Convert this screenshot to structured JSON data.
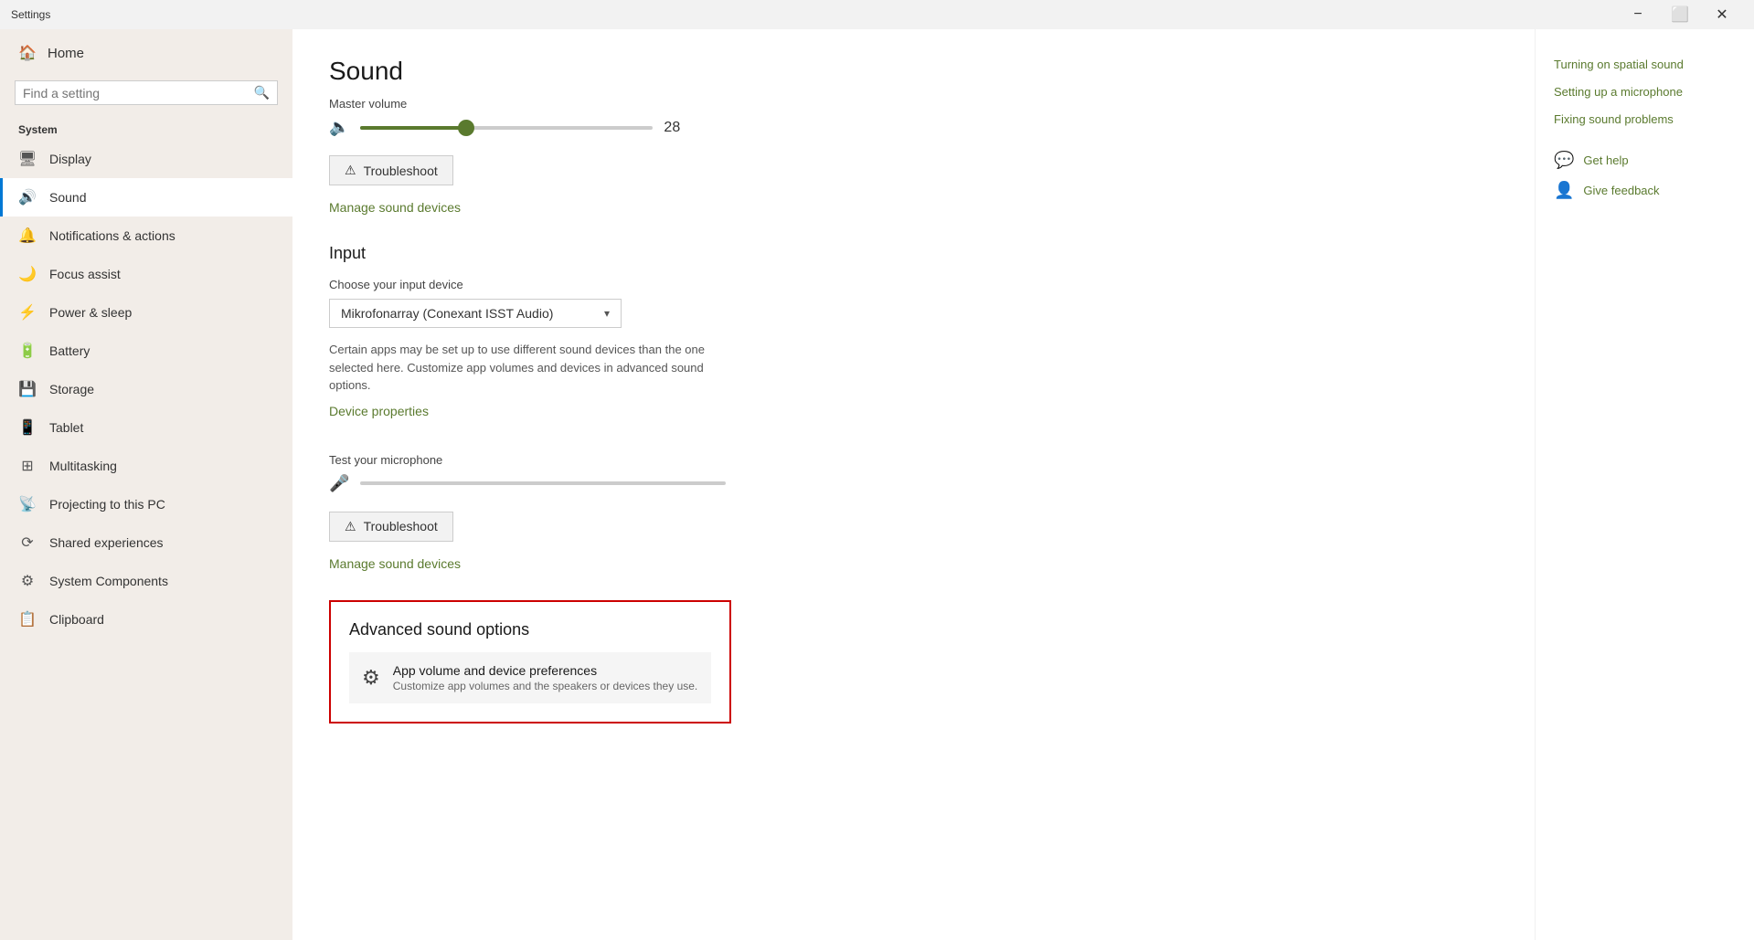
{
  "titleBar": {
    "title": "Settings",
    "minimizeLabel": "−",
    "maximizeLabel": "⬜",
    "closeLabel": "✕"
  },
  "sidebar": {
    "homeLabel": "Home",
    "searchPlaceholder": "Find a setting",
    "sectionLabel": "System",
    "items": [
      {
        "id": "display",
        "icon": "🖥",
        "label": "Display"
      },
      {
        "id": "sound",
        "icon": "🔊",
        "label": "Sound"
      },
      {
        "id": "notifications",
        "icon": "🔔",
        "label": "Notifications & actions"
      },
      {
        "id": "focus",
        "icon": "🌙",
        "label": "Focus assist"
      },
      {
        "id": "power",
        "icon": "⚡",
        "label": "Power & sleep"
      },
      {
        "id": "battery",
        "icon": "🔋",
        "label": "Battery"
      },
      {
        "id": "storage",
        "icon": "💾",
        "label": "Storage"
      },
      {
        "id": "tablet",
        "icon": "📱",
        "label": "Tablet"
      },
      {
        "id": "multitasking",
        "icon": "⊞",
        "label": "Multitasking"
      },
      {
        "id": "projecting",
        "icon": "📡",
        "label": "Projecting to this PC"
      },
      {
        "id": "shared",
        "icon": "⟳",
        "label": "Shared experiences"
      },
      {
        "id": "components",
        "icon": "⚙",
        "label": "System Components"
      },
      {
        "id": "clipboard",
        "icon": "📋",
        "label": "Clipboard"
      }
    ]
  },
  "main": {
    "pageTitle": "Sound",
    "masterVolumeLabel": "Master volume",
    "masterVolumeValue": "28",
    "masterVolumeFillPercent": 37,
    "masterVolumeThumbPercent": 36,
    "troubleshootLabel1": "Troubleshoot",
    "manageSoundDevicesLabel": "Manage sound devices",
    "inputSectionTitle": "Input",
    "chooseInputLabel": "Choose your input device",
    "inputDeviceValue": "Mikrofonarray (Conexant ISST Audio)",
    "infoText": "Certain apps may be set up to use different sound devices than the one selected here. Customize app volumes and devices in advanced sound options.",
    "devicePropertiesLabel": "Device properties",
    "testMicLabel": "Test your microphone",
    "troubleshootLabel2": "Troubleshoot",
    "manageSoundDevicesLabel2": "Manage sound devices",
    "advancedTitle": "Advanced sound options",
    "advancedItemTitle": "App volume and device preferences",
    "advancedItemSubtitle": "Customize app volumes and the speakers or devices they use."
  },
  "rightPanel": {
    "links": [
      "Turning on spatial sound",
      "Setting up a microphone",
      "Fixing sound problems"
    ],
    "helpLabel": "Get help",
    "feedbackLabel": "Give feedback"
  }
}
